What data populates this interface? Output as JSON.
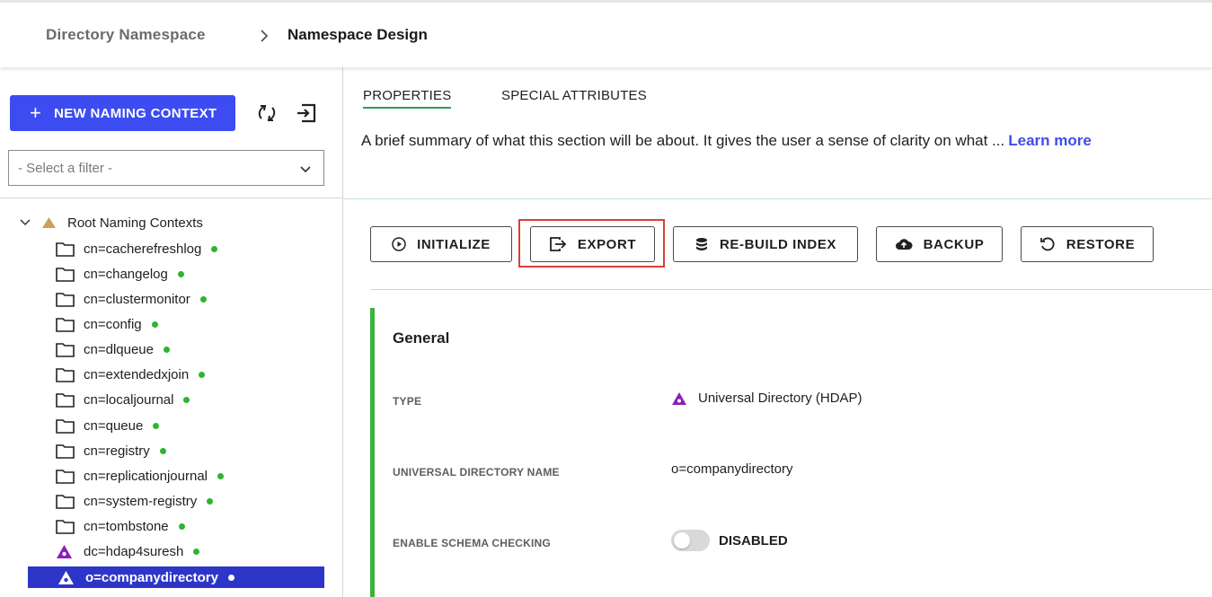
{
  "breadcrumb": {
    "parent": "Directory Namespace",
    "current": "Namespace Design"
  },
  "left_panel": {
    "new_button_label": "NEW NAMING CONTEXT",
    "filter_placeholder": "- Select a filter -",
    "tree": {
      "root_label": "Root Naming Contexts",
      "items": [
        {
          "label": "cn=cacherefreshlog",
          "icon": "folder-icon",
          "status": "green"
        },
        {
          "label": "cn=changelog",
          "icon": "folder-icon",
          "status": "green"
        },
        {
          "label": "cn=clustermonitor",
          "icon": "folder-icon",
          "status": "green"
        },
        {
          "label": "cn=config",
          "icon": "folder-icon",
          "status": "green"
        },
        {
          "label": "cn=dlqueue",
          "icon": "folder-icon",
          "status": "green"
        },
        {
          "label": "cn=extendedxjoin",
          "icon": "folder-icon",
          "status": "green"
        },
        {
          "label": "cn=localjournal",
          "icon": "folder-icon",
          "status": "green"
        },
        {
          "label": "cn=queue",
          "icon": "folder-icon",
          "status": "green"
        },
        {
          "label": "cn=registry",
          "icon": "folder-icon",
          "status": "green"
        },
        {
          "label": "cn=replicationjournal",
          "icon": "folder-icon",
          "status": "green"
        },
        {
          "label": "cn=system-registry",
          "icon": "folder-icon",
          "status": "green"
        },
        {
          "label": "cn=tombstone",
          "icon": "folder-icon",
          "status": "green"
        },
        {
          "label": "dc=hdap4suresh",
          "icon": "triangle-icon",
          "status": "green"
        },
        {
          "label": "o=companydirectory",
          "icon": "triangle-icon",
          "status": "white",
          "selected": true
        }
      ]
    }
  },
  "tabs": [
    {
      "label": "PROPERTIES",
      "active": true
    },
    {
      "label": "SPECIAL ATTRIBUTES",
      "active": false
    }
  ],
  "summary": {
    "text": "A brief summary of what this section will be about. It gives the user a sense of clarity on what ...",
    "link": "Learn more"
  },
  "actions": {
    "initialize": "INITIALIZE",
    "export": "EXPORT",
    "rebuild": "RE-BUILD INDEX",
    "backup": "BACKUP",
    "restore": "RESTORE"
  },
  "general": {
    "title": "General",
    "type_label": "TYPE",
    "type_value": "Universal Directory (HDAP)",
    "name_label": "UNIVERSAL DIRECTORY NAME",
    "name_value": "o=companydirectory",
    "schema_label": "ENABLE SCHEMA CHECKING",
    "schema_value": "DISABLED"
  },
  "colors": {
    "primary": "#3d4cf0",
    "selected": "#2e36c9",
    "status_green": "#2fb52f",
    "section_bar": "#3bb33b",
    "highlight": "#d9403a",
    "tree_root_icon": "#c9a15a",
    "triangle_icon": "#8a1fb8"
  }
}
